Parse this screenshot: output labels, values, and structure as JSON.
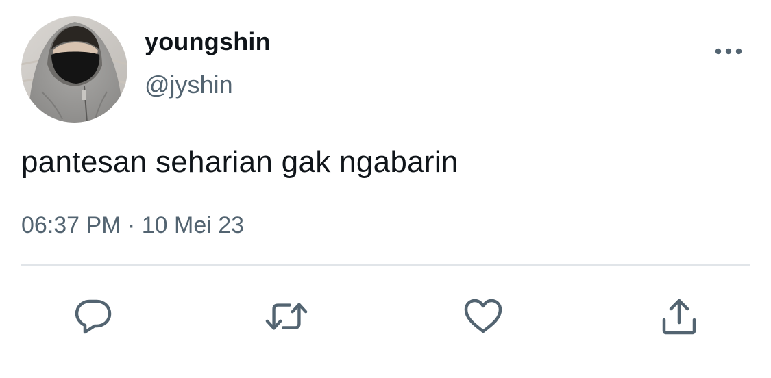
{
  "tweet": {
    "author": {
      "display_name": "youngshin",
      "handle": "@jyshin",
      "avatar": "avatar-photo-hooded-person-black-mask"
    },
    "text": "pantesan seharian gak ngabarin",
    "time": "06:37 PM",
    "separator": " · ",
    "date": "10 Mei 23"
  },
  "actions": [
    {
      "name": "reply",
      "icon": "reply-icon"
    },
    {
      "name": "retweet",
      "icon": "retweet-icon"
    },
    {
      "name": "like",
      "icon": "heart-icon"
    },
    {
      "name": "share",
      "icon": "share-icon"
    }
  ],
  "menu": {
    "icon": "more-icon"
  },
  "colors": {
    "text_primary": "#0f1419",
    "text_secondary": "#536471",
    "divider": "#e1e5e9",
    "icon": "#536471"
  }
}
